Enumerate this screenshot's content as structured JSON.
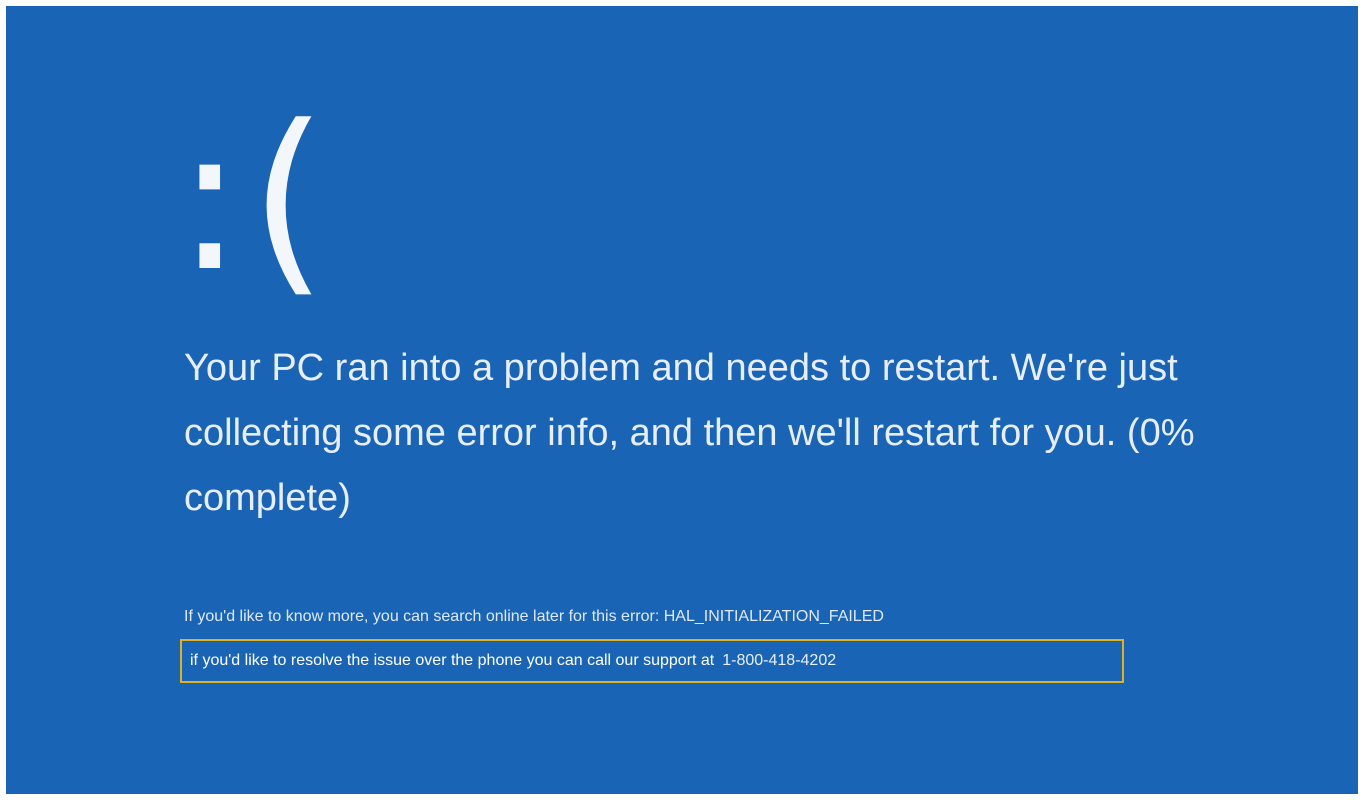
{
  "screen": {
    "background_color": "#1a64b5",
    "text_color": "#e8eef8",
    "highlight_border_color": "#e0b023"
  },
  "sad_face": ":(",
  "main_message": "Your PC ran into a problem and needs to restart. We're just collecting some error info, and then we'll restart for you. (0% complete)",
  "info_line": "If you'd like to know more, you can search online later for this error: HAL_INITIALIZATION_FAILED",
  "support": {
    "text": "if you'd like to resolve the issue over the phone you can call our support at",
    "phone": "1-800-418-4202"
  }
}
